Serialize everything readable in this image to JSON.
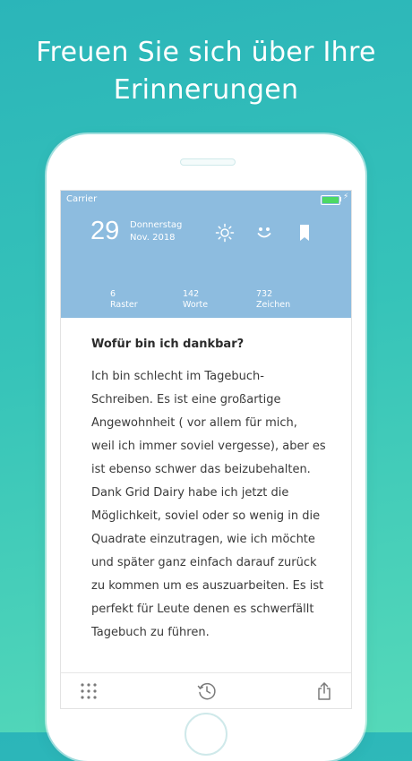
{
  "headline": {
    "line1": "Freuen Sie sich über Ihre",
    "line2": "Erinnerungen"
  },
  "status_bar": {
    "carrier": "Carrier",
    "battery_color": "#4cd964"
  },
  "header": {
    "background": "#8dbcdf",
    "day_number": "29",
    "weekday": "Donnerstag",
    "month_year": "Nov. 2018",
    "icons": [
      "sun-icon",
      "smile-icon",
      "bookmark-icon"
    ]
  },
  "stats": [
    {
      "value": "6",
      "label": "Raster"
    },
    {
      "value": "142",
      "label": "Worte"
    },
    {
      "value": "732",
      "label": "Zeichen"
    }
  ],
  "entry": {
    "question": "Wofür bin ich dankbar?",
    "lines": [
      "Ich bin schlecht im Tagebuch-",
      "Schreiben. Es ist eine großartige",
      "Angewohnheit ( vor allem für mich,",
      "weil ich immer soviel vergesse), aber es",
      "ist ebenso schwer das beizubehalten.",
      "Dank Grid Dairy habe ich jetzt die",
      "Möglichkeit, soviel oder so wenig in die",
      "Quadrate einzutragen, wie ich möchte",
      "und später ganz einfach darauf zurück",
      "zu kommen um es auszuarbeiten. Es ist",
      "perfekt für Leute denen es schwerfällt",
      "Tagebuch zu führen."
    ]
  },
  "toolbar": {
    "icons": [
      "grid-icon",
      "history-icon",
      "share-icon"
    ]
  }
}
